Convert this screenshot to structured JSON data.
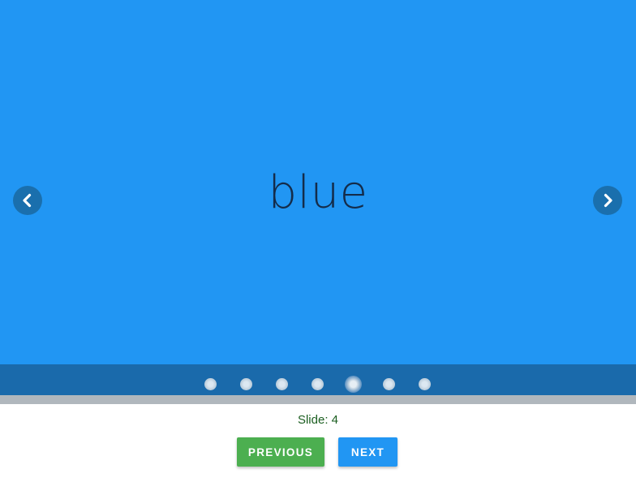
{
  "slide": {
    "text": "blue",
    "background_color": "#2196f3",
    "current_index": 4,
    "total": 7
  },
  "carousel": {
    "prev_icon": "chevron-left-icon",
    "next_icon": "chevron-right-icon",
    "dot_count": 7,
    "active_dot": 5
  },
  "status": {
    "text": "Slide: 4"
  },
  "buttons": {
    "previous_label": "PREVIOUS",
    "previous_color": "#4caf50",
    "next_label": "NEXT",
    "next_color": "#2196f3"
  }
}
